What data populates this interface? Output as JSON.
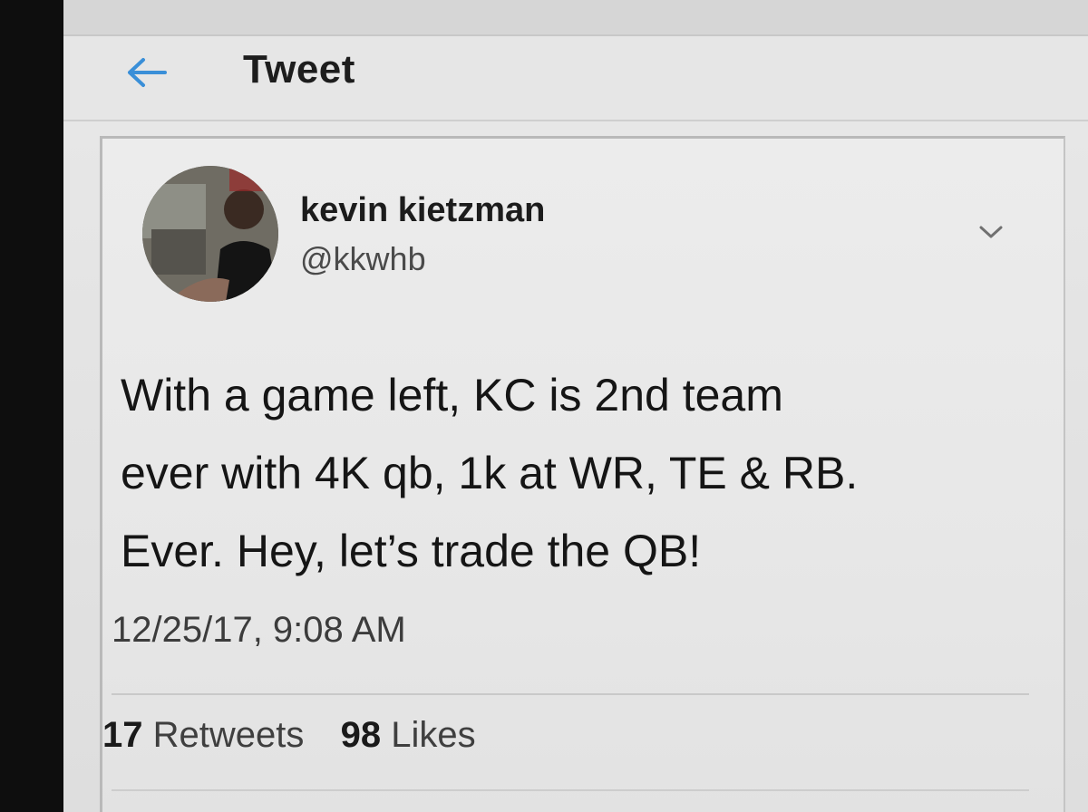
{
  "header": {
    "title": "Tweet",
    "back_icon": "arrow-left-icon",
    "accent_color": "#1da1f2"
  },
  "tweet": {
    "author": {
      "name": "kevin kietzman",
      "handle": "@kkwhb"
    },
    "menu_icon": "chevron-down-icon",
    "text_lines": [
      "With a game left, KC is 2nd team",
      "ever with 4K qb, 1k at WR, TE & RB.",
      "Ever.  Hey, let’s trade the QB!"
    ],
    "timestamp": "12/25/17, 9:08 AM",
    "stats": {
      "retweets_count": "17",
      "retweets_label": "Retweets",
      "likes_count": "98",
      "likes_label": "Likes"
    }
  }
}
